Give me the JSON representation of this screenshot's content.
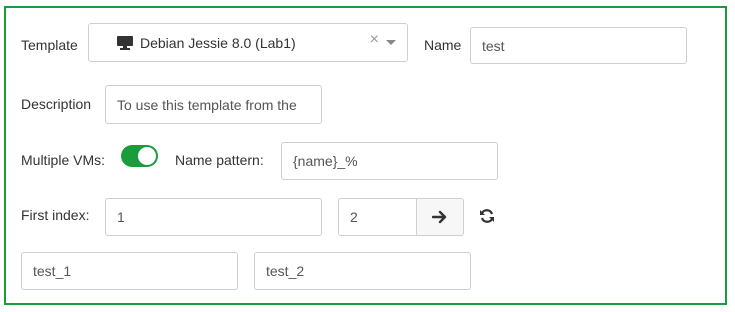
{
  "form": {
    "template_label": "Template",
    "template_value": "Debian Jessie 8.0 (Lab1)",
    "template_icon": "monitor-icon",
    "clear_glyph": "×",
    "name_label": "Name",
    "name_value": "test",
    "description_label": "Description",
    "description_value": "To use this template from the",
    "multiple_vms_label": "Multiple VMs:",
    "multiple_vms_enabled": true,
    "name_pattern_label": "Name pattern:",
    "name_pattern_value": "{name}_%",
    "first_index_label": "First index:",
    "first_index_value": "1",
    "count_value": "2",
    "preview": [
      "test_1",
      "test_2"
    ]
  },
  "colors": {
    "accent": "#1a9c3a",
    "border": "#cfcfcf"
  }
}
